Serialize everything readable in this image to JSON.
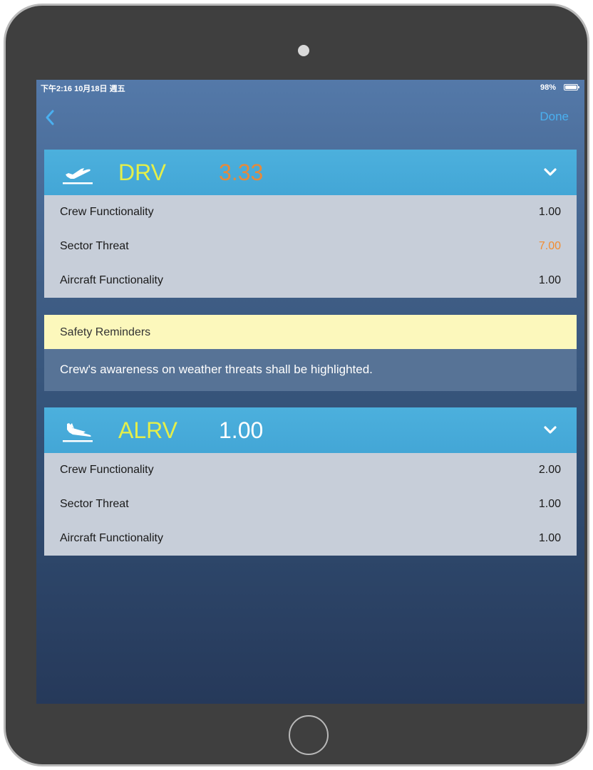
{
  "status_bar": {
    "time": "下午2:16  10月18日 週五",
    "battery": "98%"
  },
  "nav": {
    "done_label": "Done"
  },
  "stations": [
    {
      "code": "DRV",
      "score": "3.33",
      "score_color": "#e58a3c",
      "icon": "takeoff-icon",
      "rows": [
        {
          "label": "Crew Functionality",
          "value": "1.00",
          "value_color": "#1a1a1a"
        },
        {
          "label": "Sector Threat",
          "value": "7.00",
          "value_color": "#f28c30"
        },
        {
          "label": "Aircraft Functionality",
          "value": "1.00",
          "value_color": "#1a1a1a"
        }
      ]
    },
    {
      "code": "ALRV",
      "score": "1.00",
      "score_color": "#ffffff",
      "icon": "landing-icon",
      "rows": [
        {
          "label": "Crew Functionality",
          "value": "2.00",
          "value_color": "#1a1a1a"
        },
        {
          "label": "Sector Threat",
          "value": "1.00",
          "value_color": "#1a1a1a"
        },
        {
          "label": "Aircraft Functionality",
          "value": "1.00",
          "value_color": "#1a1a1a"
        }
      ]
    }
  ],
  "reminder": {
    "title": "Safety Reminders",
    "text": "Crew's awareness on weather threats shall be highlighted."
  },
  "colors": {
    "accent": "#4ab0f0",
    "station_code": "#e4ef4a",
    "header": "#47aadb"
  }
}
